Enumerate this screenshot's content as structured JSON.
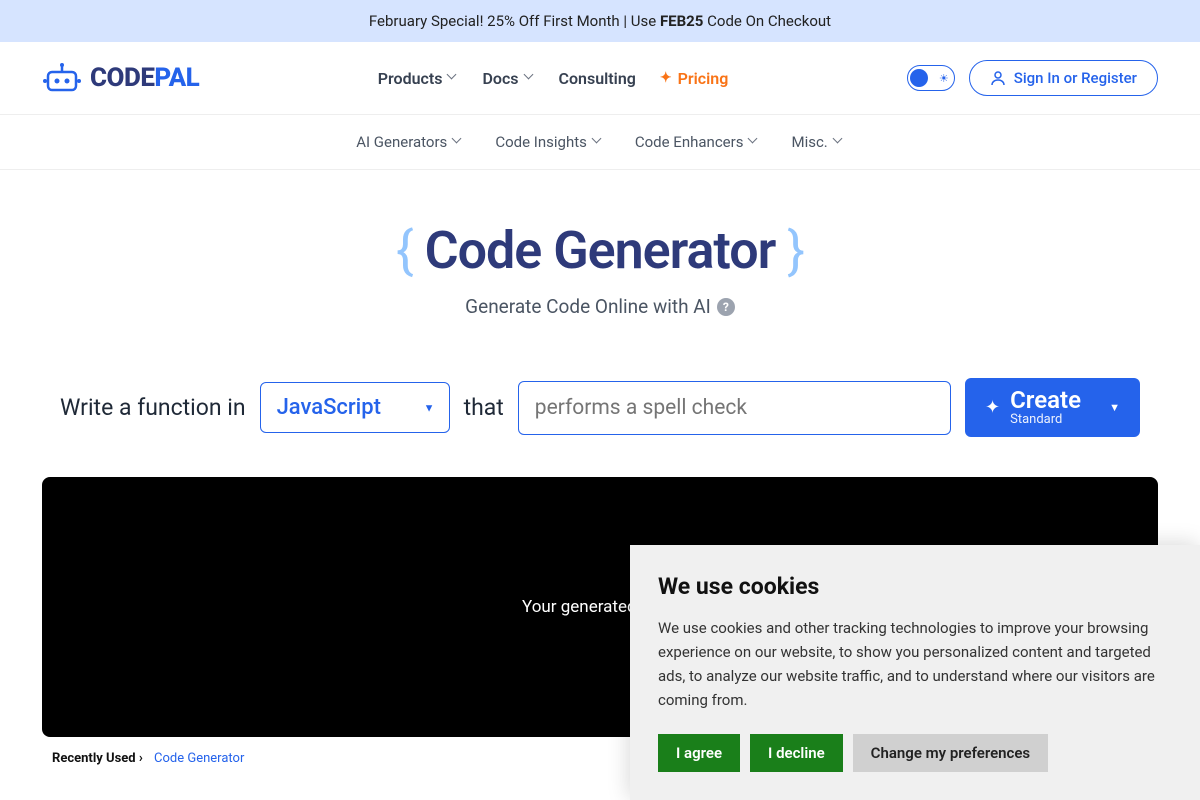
{
  "banner": {
    "prefix": "February Special! 25% Off First Month | Use ",
    "code": "FEB25",
    "suffix": " Code On Checkout"
  },
  "logo": {
    "text_a": "CODE",
    "text_b": "PAL"
  },
  "nav": {
    "products": "Products",
    "docs": "Docs",
    "consulting": "Consulting",
    "pricing": "Pricing"
  },
  "auth": {
    "signin": "Sign In or Register"
  },
  "subnav": {
    "ai_generators": "AI Generators",
    "code_insights": "Code Insights",
    "code_enhancers": "Code Enhancers",
    "misc": "Misc."
  },
  "hero": {
    "title": "Code Generator",
    "subtitle": "Generate Code Online with AI"
  },
  "prompt": {
    "prefix": "Write a function in",
    "language": "JavaScript",
    "mid": "that",
    "placeholder": "performs a spell check"
  },
  "create": {
    "label": "Create",
    "mode": "Standard"
  },
  "code_placeholder": "Your generated code",
  "recent": {
    "label": "Recently Used ›",
    "item": "Code Generator"
  },
  "cookies": {
    "title": "We use cookies",
    "body": "We use cookies and other tracking technologies to improve your browsing experience on our website, to show you personalized content and targeted ads, to analyze our website traffic, and to understand where our visitors are coming from.",
    "agree": "I agree",
    "decline": "I decline",
    "prefs": "Change my preferences"
  }
}
